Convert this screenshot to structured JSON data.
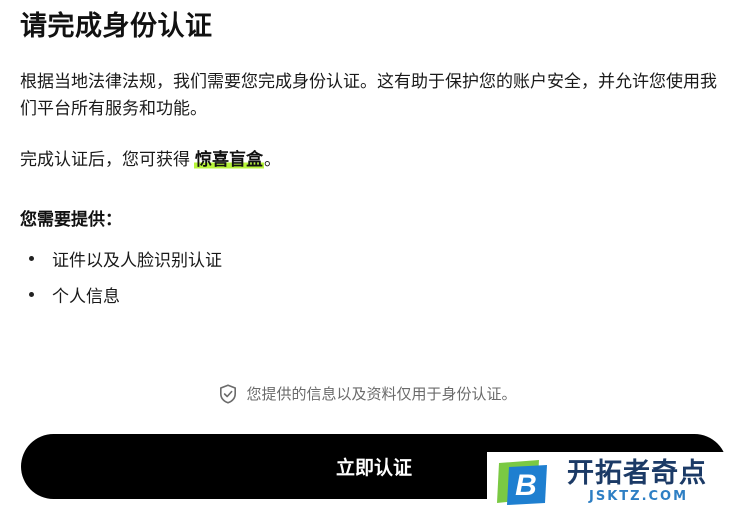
{
  "page": {
    "title": "请完成身份认证",
    "description": "根据当地法律法规，我们需要您完成身份认证。这有助于保护您的账户安全，并允许您使用我们平台所有服务和功能。",
    "reward_prefix": "完成认证后，您可获得",
    "reward_highlight": "惊喜盲盒",
    "reward_suffix": "。",
    "requirements_title": "您需要提供：",
    "requirements": [
      "证件以及人脸识别认证",
      "个人信息"
    ],
    "privacy_note": "您提供的信息以及资料仅用于身份认证。",
    "privacy_icon": "shield-check-icon",
    "verify_button": "立即认证",
    "highlight_color": "#b8f53a",
    "button_color": "#000000"
  },
  "watermark": {
    "logo_letter": "B",
    "name": "开拓者奇点",
    "domain": "JSKTZ.COM"
  }
}
